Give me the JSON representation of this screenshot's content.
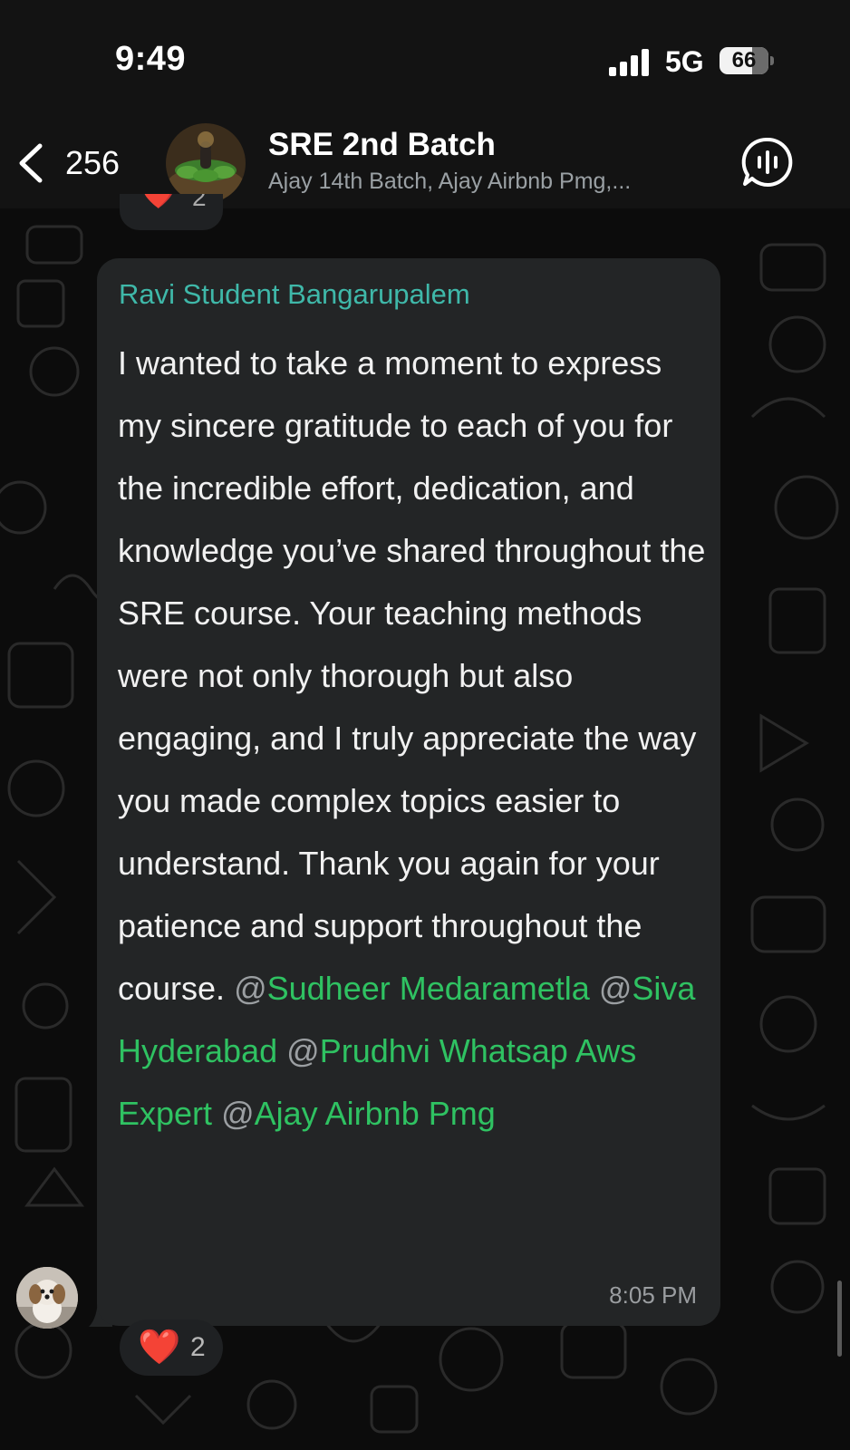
{
  "status_bar": {
    "time": "9:49",
    "network": "5G",
    "battery": "66",
    "battery_level": 0.66
  },
  "header": {
    "unread_count": "256",
    "title": "SRE 2nd Batch",
    "subtitle": "Ajay 14th Batch, Ajay Airbnb Pmg,..."
  },
  "previous_message": {
    "reaction_emoji": "❤️",
    "reaction_count": "2"
  },
  "message": {
    "sender": "Ravi Student Bangarupalem",
    "text": "I wanted to take a moment to express my sincere gratitude to each of you for the incredible effort, dedication, and knowledge you’ve shared throughout the SRE course. Your teaching methods were not only thorough but also engaging, and I truly appreciate the way you made complex topics easier to understand. Thank you again for your patience and support throughout the course.",
    "mentions": [
      {
        "at": "@",
        "name": "Sudheer Medarametla"
      },
      {
        "at": "@",
        "name": "Siva Hyderabad"
      },
      {
        "at": "@",
        "name": "Prudhvi Whatsap Aws Expert"
      },
      {
        "at": "@",
        "name": "Ajay Airbnb Pmg"
      }
    ],
    "time": "8:05 PM",
    "reaction_emoji": "❤️",
    "reaction_count": "2"
  },
  "colors": {
    "sender_name": "#3fb8a9",
    "mention": "#2fc262",
    "bubble": "#232526",
    "heart": "#e0242f"
  }
}
